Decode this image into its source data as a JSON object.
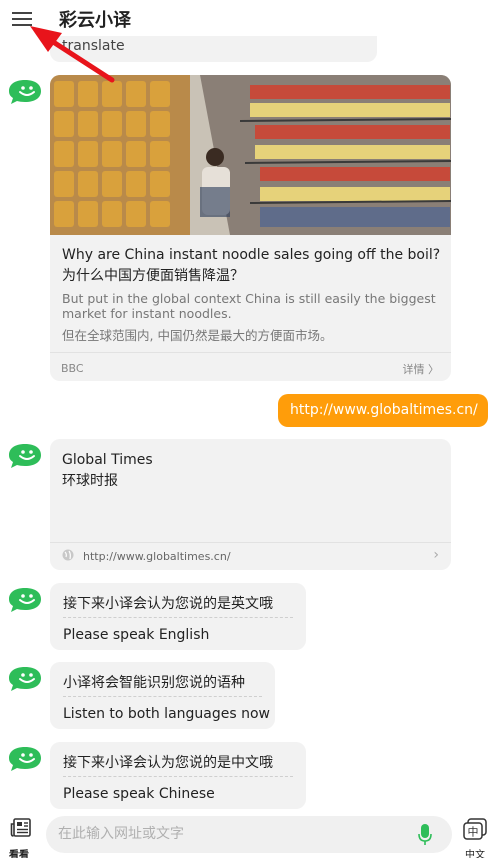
{
  "header": {
    "title": "彩云小译"
  },
  "previous_message": {
    "text": "translate"
  },
  "news": {
    "title_en": "Why are China instant noodle sales going off the boil?",
    "title_zh": "为什么中国方便面销售降温？",
    "desc_en": "But put in the global context China is still easily the biggest market for instant noodles.",
    "desc_zh": "但在全球范围内, 中国仍然是最大的方便面市场。",
    "source": "BBC",
    "detail_label": "详情 〉"
  },
  "user_message": {
    "text": "http://www.globaltimes.cn/"
  },
  "site_card": {
    "name_en": "Global Times",
    "name_zh": "环球时报",
    "url": "http://www.globaltimes.cn/",
    "chevron": "›"
  },
  "messages": [
    {
      "zh": "接下来小译会认为您说的是英文哦",
      "en": "Please speak English"
    },
    {
      "zh": "小译将会智能识别您说的语种",
      "en": "Listen to both languages now"
    },
    {
      "zh": "接下来小译会认为您说的是中文哦",
      "en": "Please speak Chinese"
    }
  ],
  "bottom": {
    "kan_label": "看看",
    "input_placeholder": "在此输入网址或文字",
    "lang_label": "中文",
    "lang_icon_char": "中"
  },
  "colors": {
    "accent_orange": "#ff9d0a",
    "bot_green": "#2ebd59",
    "arrow_red": "#e8141b",
    "bubble_gray": "#f2f2f2"
  },
  "icons": [
    "menu-icon",
    "bot-avatar-icon",
    "globe-icon",
    "chevron-right-icon",
    "news-icon",
    "mic-icon",
    "language-icon"
  ]
}
